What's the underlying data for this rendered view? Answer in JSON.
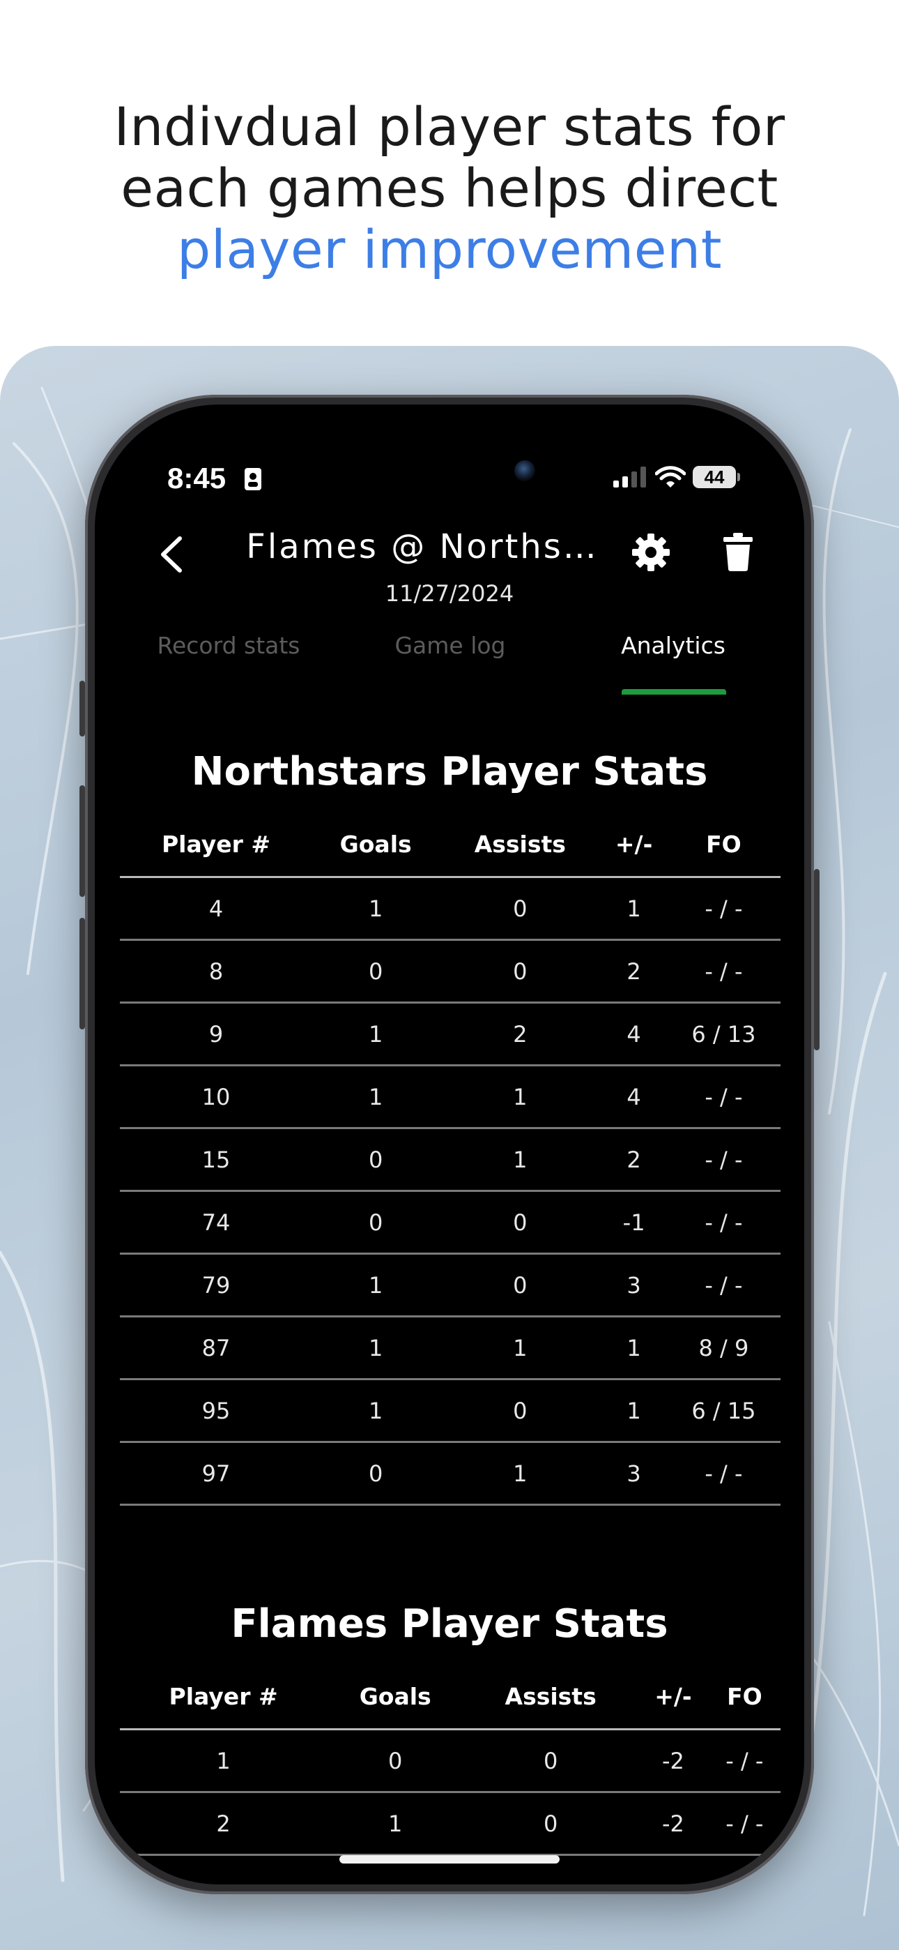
{
  "headline": {
    "line1": "Indivdual player stats for",
    "line2": "each games helps direct",
    "accent": "player improvement"
  },
  "status_bar": {
    "time": "8:45",
    "battery": "44"
  },
  "nav": {
    "title": "Flames @ Norths…",
    "date": "11/27/2024"
  },
  "tabs": [
    {
      "label": "Record stats",
      "active": false
    },
    {
      "label": "Game log",
      "active": false
    },
    {
      "label": "Analytics",
      "active": true
    }
  ],
  "tables": [
    {
      "title": "Northstars Player Stats",
      "headers": [
        "Player #",
        "Goals",
        "Assists",
        "+/-",
        "FO"
      ],
      "rows": [
        [
          "4",
          "1",
          "0",
          "1",
          "- / -"
        ],
        [
          "8",
          "0",
          "0",
          "2",
          "- / -"
        ],
        [
          "9",
          "1",
          "2",
          "4",
          "6 / 13"
        ],
        [
          "10",
          "1",
          "1",
          "4",
          "- / -"
        ],
        [
          "15",
          "0",
          "1",
          "2",
          "- / -"
        ],
        [
          "74",
          "0",
          "0",
          "-1",
          "- / -"
        ],
        [
          "79",
          "1",
          "0",
          "3",
          "- / -"
        ],
        [
          "87",
          "1",
          "1",
          "1",
          "8 / 9"
        ],
        [
          "95",
          "1",
          "0",
          "1",
          "6 / 15"
        ],
        [
          "97",
          "0",
          "1",
          "3",
          "- / -"
        ]
      ]
    },
    {
      "title": "Flames Player Stats",
      "headers": [
        "Player #",
        "Goals",
        "Assists",
        "+/-",
        "FO"
      ],
      "rows": [
        [
          "1",
          "0",
          "0",
          "-2",
          "- / -"
        ],
        [
          "2",
          "1",
          "0",
          "-2",
          "- / -"
        ]
      ]
    }
  ],
  "colors": {
    "accent": "#3d7ee6",
    "tab_indicator": "#1f9a3c"
  },
  "icons": [
    "back-chevron-icon",
    "gear-icon",
    "trash-icon",
    "wifi-icon",
    "signal-icon",
    "id-card-icon"
  ]
}
